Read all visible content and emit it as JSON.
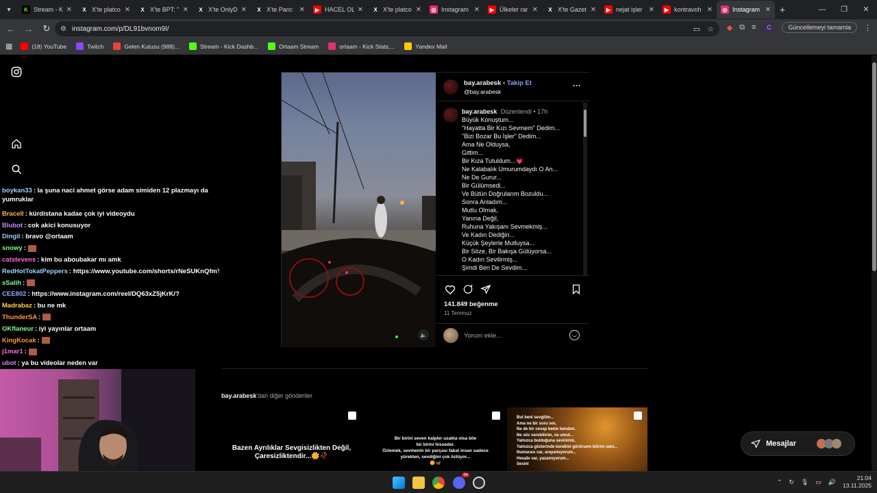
{
  "browser": {
    "tabs": [
      {
        "label": "Stream - K",
        "icon": "kick",
        "color": "#53fc18"
      },
      {
        "label": "X'te platco",
        "icon": "x",
        "color": "#ffffff"
      },
      {
        "label": "X'te BPT: \"",
        "icon": "x",
        "color": "#ffffff"
      },
      {
        "label": "X'te OnlyD",
        "icon": "x",
        "color": "#ffffff"
      },
      {
        "label": "X'te Paro:",
        "icon": "x",
        "color": "#ffffff"
      },
      {
        "label": "HACEL OL",
        "icon": "youtube",
        "color": "#ff0000"
      },
      {
        "label": "X'te platco",
        "icon": "x",
        "color": "#ffffff"
      },
      {
        "label": "Instagram",
        "icon": "instagram",
        "color": "#e1306c"
      },
      {
        "label": "Ülkeler rar",
        "icon": "youtube",
        "color": "#ff0000"
      },
      {
        "label": "X'te Gazet",
        "icon": "x",
        "color": "#ffffff"
      },
      {
        "label": "nejat işler",
        "icon": "youtube",
        "color": "#ff0000"
      },
      {
        "label": "kontravoh",
        "icon": "youtube",
        "color": "#ff0000"
      },
      {
        "label": "Instagram",
        "icon": "instagram",
        "color": "#e1306c",
        "active": true
      }
    ],
    "url": "instagram.com/p/DL91bvnom9I/",
    "profile_initial": "C",
    "update_label": "Güncellemeyi tamamla",
    "bookmarks": [
      {
        "label": "(18) YouTube",
        "color": "#ff0000",
        "icon": "youtube"
      },
      {
        "label": "Twitch",
        "color": "#9146ff",
        "icon": "twitch"
      },
      {
        "label": "Gelen Kutusu (988)...",
        "color": "#ea4335",
        "icon": "gmail"
      },
      {
        "label": "Stream - Kick Dashb...",
        "color": "#53fc18",
        "icon": "kick"
      },
      {
        "label": "Ortaam Stream",
        "color": "#53fc18",
        "icon": "kick"
      },
      {
        "label": "ortaam - Kick Stats,...",
        "color": "#e1306c",
        "icon": "kickstats"
      },
      {
        "label": "Yandex Mail",
        "color": "#ffcc00",
        "icon": "mail"
      }
    ]
  },
  "chat": [
    {
      "user": "boykan33",
      "color": "#9ad7ff",
      "text": ": la şuna naci ahmet görse adam simiden 12 plazmayı da",
      "cont": "yumruklar"
    },
    {
      "user": "Bracell",
      "color": "#ffb84d",
      "text": ": kürdistana kadae çok iyi videoydu"
    },
    {
      "user": "Blubot",
      "color": "#c38cff",
      "text": ": cok akici konusuyor"
    },
    {
      "user": "Dingil",
      "color": "#9ad7ff",
      "text": ": bravo @ortaam"
    },
    {
      "user": "snowy",
      "color": "#7dff8a",
      "text": ":"
    },
    {
      "user": "catstevens",
      "color": "#ff6fd8",
      "text": ": kim bu aboubakar mı amk"
    },
    {
      "user": "RedHotTokatPeppers",
      "color": "#9ad7ff",
      "text": ": https://www.youtube.com/shorts/rNeSUKnQfmY"
    },
    {
      "user": "sSalih",
      "color": "#7dff8a",
      "text": ":"
    },
    {
      "user": "CEE802",
      "color": "#8fa8ff",
      "text": ": https://www.instagram.com/reel/DQ63xZ5jKrK/?"
    },
    {
      "user": "Madrabaz",
      "color": "#ffd24d",
      "text": ": bu ne mk"
    },
    {
      "user": "ThunderSA",
      "color": "#ff9a3c",
      "text": ":"
    },
    {
      "user": "OKflaneur",
      "color": "#7dff8a",
      "text": ": iyi yayınlar ortaam"
    },
    {
      "user": "KingKocak",
      "color": "#ff9a3c",
      "text": ":"
    },
    {
      "user": "j1mar1",
      "color": "#ff6fd8",
      "text": ":"
    },
    {
      "user": "ubot",
      "color": "#c38cff",
      "text": ": ya bu videolar neden var"
    }
  ],
  "post": {
    "username": "bay.arabesk",
    "follow": "Takip Et",
    "handle": "@bay.arabesk",
    "edited": "Düzenlendi",
    "time": "17h",
    "caption_lines": [
      "Büyük Konuştum...",
      "\"Hayatta Bir Kızı Sevmem\" Dedim...",
      "\"Bizi Bozar Bu İşler\" Dedim...",
      "Ama Ne Olduysa,",
      "Gittim...",
      "Bir Kıza Tutuldum...💗",
      "Ne Kalabalık Umurumdaydı O An...",
      "Ne De Gurur...",
      "Bir Gülümsedi...",
      "Ve Bütün Doğrularım Bozuldu...",
      "Sonra Anladım...",
      "Mutlu Olmak,",
      "Yanına Değil,",
      "Ruhuna Yakışanı Sevmekmiş...",
      "Ve Kadın Dediğin...",
      "Küçük Şeylerle Mutluysa...",
      "Bir Söze, Bir Bakışa Gülüyorsa...",
      "O Kadın Sevilirmiş...",
      "Şimdi Ben De Sevdim..."
    ],
    "likes": "141.849 beğenme",
    "date": "11 Temmuz",
    "comment_placeholder": "Yorum ekle..."
  },
  "more": {
    "user": "bay.arabesk",
    "suffix": "'dan diğer gönderiler",
    "thumbs": [
      {
        "lines": [
          "Bazen Ayrılıklar Sevgisizlikten Değil,",
          "Çaresizliktendir...🌼🥀"
        ]
      },
      {
        "lines": [
          "Bir birini seven kalpler uzakta olsa bile",
          "bir birini hisseder.",
          "Özlemek, sevmenin bir parçası fakat insan sadece",
          "yürekten, sevdiğini çok özlüyor...",
          "🌼🦋"
        ]
      },
      {
        "lines": [
          "Bul beni sevgilim...",
          "Ama ne bir soru sor,",
          "Ne de bir cevap bekle benden.",
          "Ne söz verebilirim, ne umut...",
          "Yalnızca bulduğuna sevinirim,",
          "Yalnızca gözlerinde kendimi görürsem bilirim seni...",
          "Numarası var, arayamıyorum...",
          "Hesabı var, yazamıyorum...",
          "Sesini"
        ]
      }
    ]
  },
  "messages_label": "Mesajlar",
  "taskbar": {
    "time": "21:04",
    "date": "13.11.2025",
    "discord_badge": "94"
  }
}
